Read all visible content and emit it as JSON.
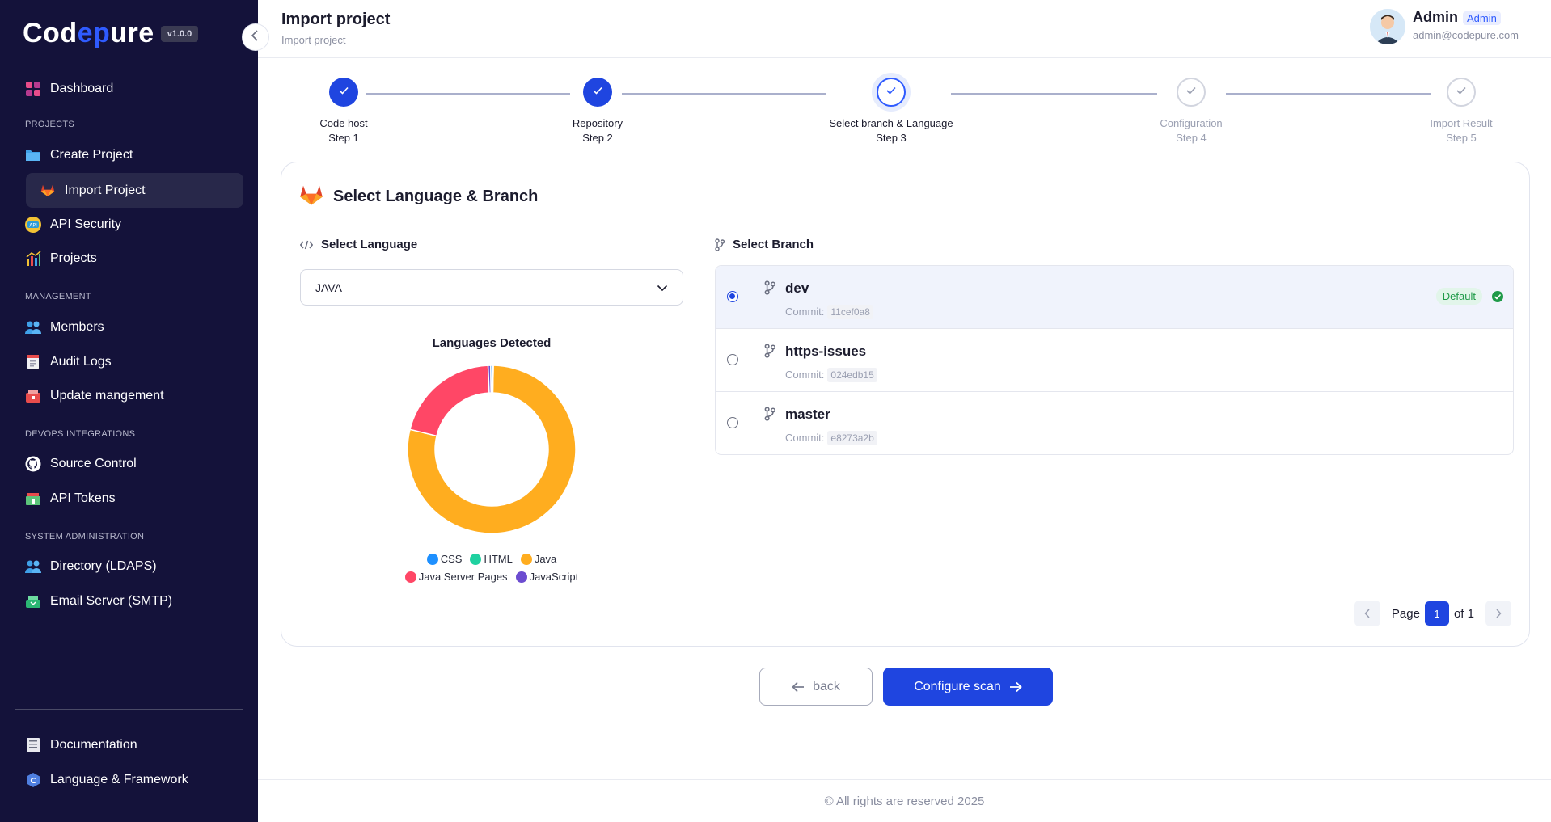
{
  "brand": {
    "logo_prefix": "Cod",
    "logo_accent": "ep",
    "logo_suffix": "ure",
    "version": "v1.0.0"
  },
  "sidebar": {
    "items": [
      {
        "label": "Dashboard",
        "icon": "dashboard-icon"
      },
      {
        "label": "Create Project",
        "icon": "folder-icon"
      },
      {
        "label": "Import Project",
        "icon": "gitlab-icon",
        "active": true
      },
      {
        "label": "API Security",
        "icon": "api-security-icon"
      },
      {
        "label": "Projects",
        "icon": "bar-chart-icon"
      },
      {
        "label": "Members",
        "icon": "members-icon"
      },
      {
        "label": "Audit Logs",
        "icon": "audit-log-icon"
      },
      {
        "label": "Update mangement",
        "icon": "update-icon"
      },
      {
        "label": "Source Control",
        "icon": "github-icon"
      },
      {
        "label": "API Tokens",
        "icon": "token-icon"
      },
      {
        "label": "Directory (LDAPS)",
        "icon": "directory-icon"
      },
      {
        "label": "Email Server (SMTP)",
        "icon": "email-server-icon"
      },
      {
        "label": "Documentation",
        "icon": "documentation-icon"
      },
      {
        "label": "Language & Framework",
        "icon": "language-icon"
      }
    ],
    "sections": {
      "projects": "PROJECTS",
      "management": "MANAGEMENT",
      "devops": "DEVOPS INTEGRATIONS",
      "sysadmin": "SYSTEM ADMINISTRATION"
    }
  },
  "header": {
    "title": "Import project",
    "breadcrumb": "Import project",
    "user_name": "Admin",
    "user_role": "Admin",
    "user_email": "admin@codepure.com"
  },
  "stepper": {
    "steps": [
      {
        "title": "Code host",
        "sub": "Step 1",
        "state": "done"
      },
      {
        "title": "Repository",
        "sub": "Step 2",
        "state": "done"
      },
      {
        "title": "Select branch & Language",
        "sub": "Step 3",
        "state": "current"
      },
      {
        "title": "Configuration",
        "sub": "Step 4",
        "state": "pending"
      },
      {
        "title": "Import Result",
        "sub": "Step 5",
        "state": "pending"
      }
    ]
  },
  "card": {
    "title": "Select Language & Branch",
    "language_label": "Select Language",
    "language_value": "JAVA",
    "branch_label": "Select Branch"
  },
  "chart_data": {
    "type": "pie",
    "title": "Languages Detected",
    "categories": [
      "CSS",
      "HTML",
      "Java",
      "Java Server Pages",
      "JavaScript"
    ],
    "values": [
      0.3,
      0.2,
      78.5,
      20.5,
      0.5
    ],
    "colors": [
      "#1e90ff",
      "#1fd1a0",
      "#ffad1f",
      "#ff4766",
      "#6c4cd0"
    ],
    "legend": "bottom"
  },
  "branches": [
    {
      "name": "dev",
      "commit_label": "Commit:",
      "commit": "11cef0a8",
      "selected": true,
      "badge": "Default"
    },
    {
      "name": "https-issues",
      "commit_label": "Commit:",
      "commit": "024edb15",
      "selected": false,
      "badge": ""
    },
    {
      "name": "master",
      "commit_label": "Commit:",
      "commit": "e8273a2b",
      "selected": false,
      "badge": ""
    }
  ],
  "pagination": {
    "page_label": "Page",
    "current": "1",
    "of_label": "of 1"
  },
  "actions": {
    "back_label": "back",
    "next_label": "Configure scan"
  },
  "footer": {
    "text": "© All rights are reserved 2025"
  },
  "colors": {
    "sidebar_bg": "#14123a",
    "primary": "#1f45e0",
    "success": "#1f9a48"
  }
}
